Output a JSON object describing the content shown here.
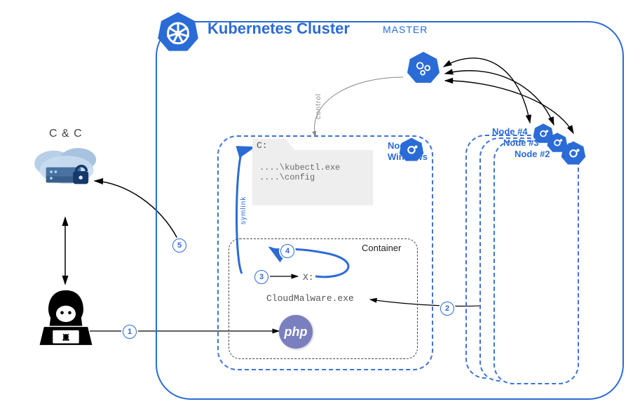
{
  "cluster": {
    "title": "Kubernetes Cluster",
    "master_label": "MASTER",
    "node1": {
      "label_line1": "Node #1",
      "label_line2": "Windows",
      "file_window": {
        "tab": "C:",
        "lines": "....\\kubectl.exe\n....\\config"
      },
      "container": {
        "label": "Container",
        "drive": "X:",
        "malware": "CloudMalware.exe",
        "php": "php"
      }
    },
    "other_nodes": {
      "n2": "Node #2",
      "n3": "Node #3",
      "n4": "Node #4"
    },
    "control_label": "control",
    "symlink_label": "symlink"
  },
  "external": {
    "cc_label": "C & C"
  },
  "steps": {
    "1": "1",
    "2": "2",
    "3": "3",
    "4": "4",
    "5": "5"
  },
  "colors": {
    "blue": "#2a6bd6",
    "grey": "#6a6a6a"
  }
}
